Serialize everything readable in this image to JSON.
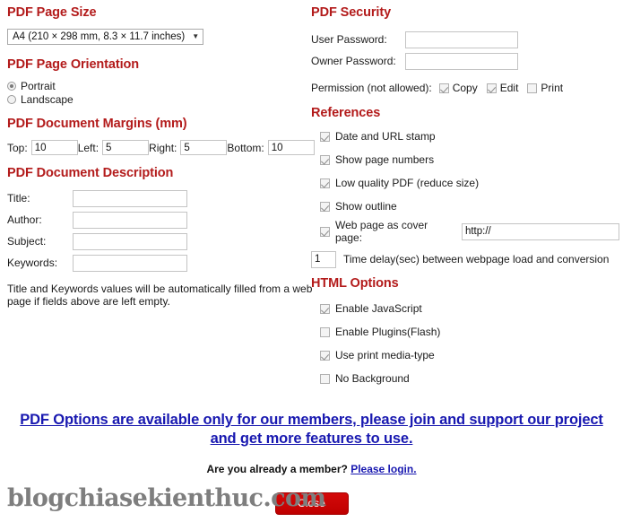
{
  "left": {
    "page_size": {
      "heading": "PDF Page Size",
      "selected": "A4 (210 × 298 mm, 8.3 × 11.7 inches)",
      "caret": "▼",
      "options": [
        "A4 (210 × 298 mm, 8.3 × 11.7 inches)"
      ]
    },
    "orientation": {
      "heading": "PDF Page Orientation",
      "options": [
        {
          "label": "Portrait",
          "checked": true
        },
        {
          "label": "Landscape",
          "checked": false
        }
      ]
    },
    "margins": {
      "heading": "PDF Document Margins (mm)",
      "fields": [
        {
          "label": "Top:",
          "value": "10"
        },
        {
          "label": "Left:",
          "value": "5"
        },
        {
          "label": "Right:",
          "value": "5"
        },
        {
          "label": "Bottom:",
          "value": "10"
        }
      ]
    },
    "description": {
      "heading": "PDF Document Description",
      "fields": [
        {
          "label": "Title:",
          "value": ""
        },
        {
          "label": "Author:",
          "value": ""
        },
        {
          "label": "Subject:",
          "value": ""
        },
        {
          "label": "Keywords:",
          "value": ""
        }
      ],
      "note": "Title and Keywords values will be automatically filled from a web page if fields above are left empty."
    }
  },
  "right": {
    "security": {
      "heading": "PDF Security",
      "user_password_label": "User Password:",
      "user_password_value": "",
      "owner_password_label": "Owner Password:",
      "owner_password_value": "",
      "permission_label": "Permission (not allowed):",
      "permissions": [
        {
          "label": "Copy",
          "checked": true
        },
        {
          "label": "Edit",
          "checked": true
        },
        {
          "label": "Print",
          "checked": false
        }
      ]
    },
    "references": {
      "heading": "References",
      "items": [
        {
          "label": "Date and URL stamp",
          "checked": true
        },
        {
          "label": "Show page numbers",
          "checked": true
        },
        {
          "label": "Low quality PDF (reduce size)",
          "checked": true
        },
        {
          "label": "Show outline",
          "checked": true
        }
      ],
      "cover": {
        "label": "Web page as cover page:",
        "checked": true,
        "value": "http://"
      },
      "delay": {
        "value": "1",
        "label": "Time delay(sec) between webpage load and conversion"
      }
    },
    "html_options": {
      "heading": "HTML Options",
      "items": [
        {
          "label": "Enable JavaScript",
          "checked": true
        },
        {
          "label": "Enable Plugins(Flash)",
          "checked": false
        },
        {
          "label": "Use print media-type",
          "checked": true
        },
        {
          "label": "No Background",
          "checked": false
        }
      ]
    }
  },
  "footer": {
    "promo_text": "PDF Options are available only for our members, please join and support our project and get more features to use.",
    "member_question": "Are you already a member?",
    "member_link": "Please login.",
    "close_label": "Close"
  },
  "watermark": "blogchiasekienthuc.com",
  "colors": {
    "heading": "#b31b1b",
    "link": "#1818b0",
    "close_button": "#cc0000",
    "watermark": "#7e7e7e"
  }
}
